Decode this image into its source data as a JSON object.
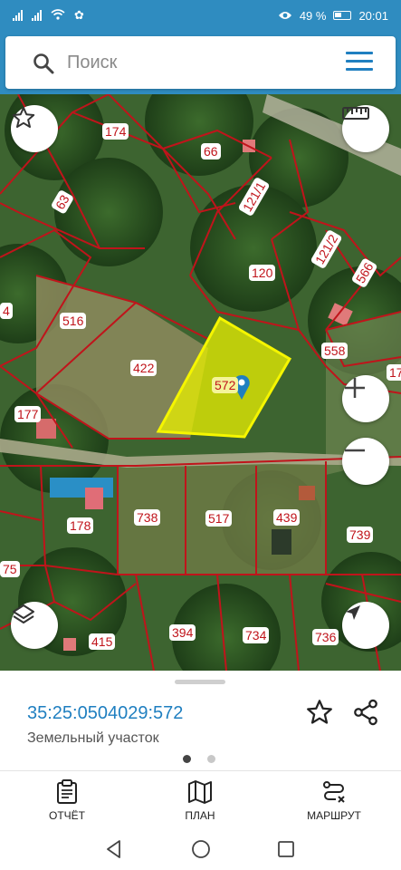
{
  "status": {
    "battery": "49 %",
    "time": "20:01"
  },
  "search": {
    "placeholder": "Поиск"
  },
  "map": {
    "selected_parcel_label": "572",
    "parcels": [
      {
        "label": "174"
      },
      {
        "label": "66"
      },
      {
        "label": "63"
      },
      {
        "label": "121/1"
      },
      {
        "label": "121/2"
      },
      {
        "label": "566"
      },
      {
        "label": "120"
      },
      {
        "label": "516"
      },
      {
        "label": "558"
      },
      {
        "label": "422"
      },
      {
        "label": "177"
      },
      {
        "label": "178"
      },
      {
        "label": "738"
      },
      {
        "label": "517"
      },
      {
        "label": "439"
      },
      {
        "label": "739"
      },
      {
        "label": "394"
      },
      {
        "label": "734"
      },
      {
        "label": "736"
      },
      {
        "label": "415"
      },
      {
        "label": "4"
      },
      {
        "label": "75"
      },
      {
        "label": "17"
      }
    ]
  },
  "sheet": {
    "parcel_id": "35:25:0504029:572",
    "parcel_type": "Земельный участок",
    "page_count": 2,
    "active_page": 1
  },
  "nav": {
    "report": "ОТЧЁТ",
    "plan": "ПЛАН",
    "route": "МАРШРУТ"
  },
  "colors": {
    "accent": "#1f7fc0",
    "statusbar": "#2f8cc0",
    "parcel_border": "#c0141b",
    "selection": "#f2f200"
  }
}
